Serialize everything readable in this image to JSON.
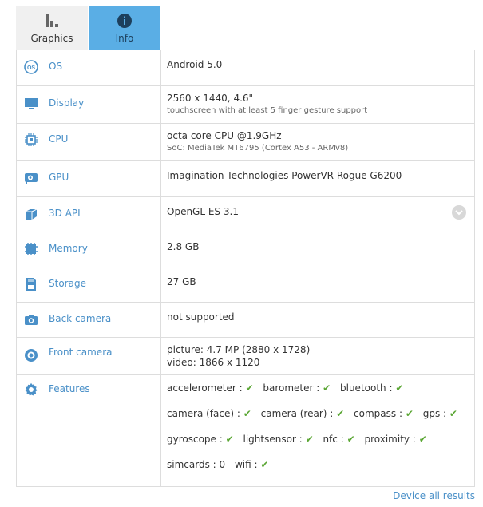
{
  "tabs": [
    {
      "label": "Graphics",
      "icon": "bar-chart-icon"
    },
    {
      "label": "Info",
      "icon": "info-icon"
    }
  ],
  "rows": [
    {
      "label": "OS",
      "icon": "os-icon",
      "value": "Android 5.0",
      "sub": ""
    },
    {
      "label": "Display",
      "icon": "display-icon",
      "value": "2560 x 1440, 4.6\"",
      "sub": "touchscreen with at least 5 finger gesture support"
    },
    {
      "label": "CPU",
      "icon": "cpu-icon",
      "value": "octa core CPU @1.9GHz",
      "sub": "SoC: MediaTek MT6795 (Cortex A53 - ARMv8)"
    },
    {
      "label": "GPU",
      "icon": "gpu-icon",
      "value": "Imagination Technologies PowerVR Rogue G6200",
      "sub": ""
    },
    {
      "label": "3D API",
      "icon": "3d-api-icon",
      "value": "OpenGL ES 3.1",
      "sub": ""
    },
    {
      "label": "Memory",
      "icon": "memory-icon",
      "value": "2.8 GB",
      "sub": ""
    },
    {
      "label": "Storage",
      "icon": "storage-icon",
      "value": "27 GB",
      "sub": ""
    },
    {
      "label": "Back camera",
      "icon": "camera-icon",
      "value": "not supported",
      "sub": ""
    },
    {
      "label": "Front camera",
      "icon": "front-camera-icon",
      "value": "picture: 4.7 MP (2880 x 1728)",
      "value2": "video: 1866 x 1120"
    },
    {
      "label": "Features",
      "icon": "gear-icon"
    }
  ],
  "features": [
    [
      {
        "text": "accelerometer :",
        "check": true
      },
      {
        "text": "barometer :",
        "check": true
      },
      {
        "text": "bluetooth :",
        "check": true
      }
    ],
    [
      {
        "text": "camera (face) :",
        "check": true
      },
      {
        "text": "camera (rear) :",
        "check": true
      },
      {
        "text": "compass :",
        "check": true
      },
      {
        "text": "gps :",
        "check": true
      }
    ],
    [
      {
        "text": "gyroscope :",
        "check": true
      },
      {
        "text": "lightsensor :",
        "check": true
      },
      {
        "text": "nfc :",
        "check": true
      },
      {
        "text": "proximity :",
        "check": true
      }
    ],
    [
      {
        "text": "simcards : 0",
        "check": false
      },
      {
        "text": "wifi :",
        "check": true
      }
    ]
  ],
  "check_glyph": "✔",
  "footer": {
    "link": "Device all results"
  },
  "colors": {
    "accent": "#4a90c8",
    "tab_active": "#5aaee5",
    "check": "#5aa633",
    "border": "#dddddd"
  }
}
